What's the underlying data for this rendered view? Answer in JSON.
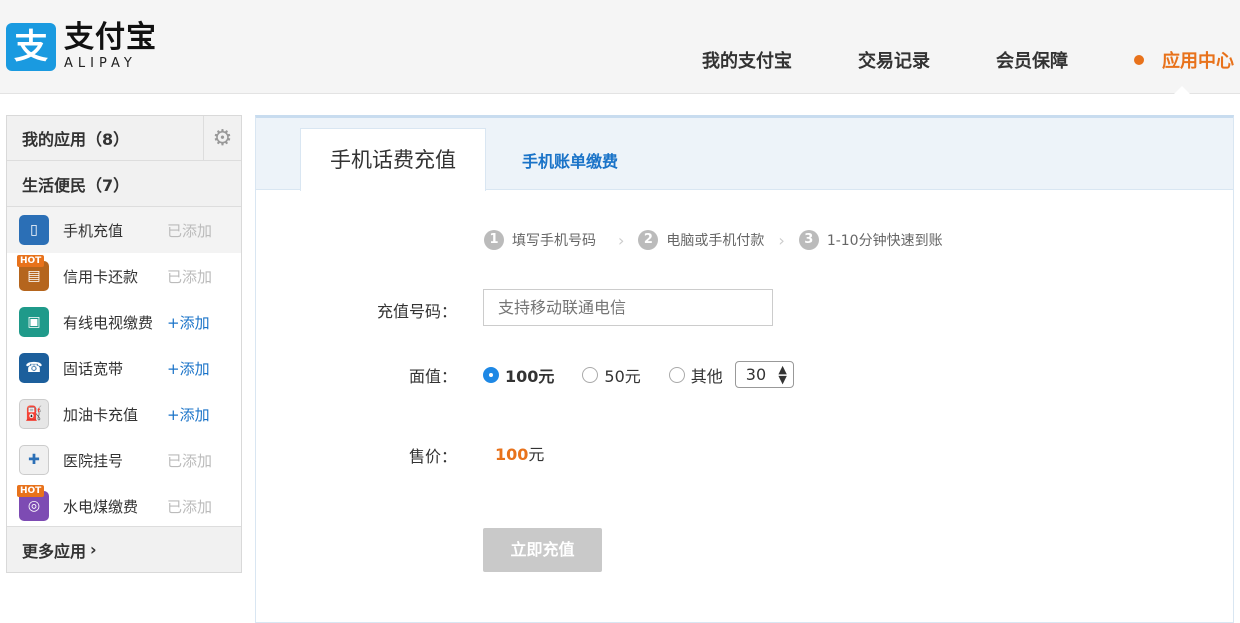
{
  "header": {
    "logo_mark": "支",
    "logo_cn": "支付宝",
    "logo_en": "ALIPAY",
    "nav": [
      {
        "label": "我的支付宝"
      },
      {
        "label": "交易记录"
      },
      {
        "label": "会员保障"
      },
      {
        "label": "应用中心"
      }
    ]
  },
  "sidebar": {
    "my_apps": "我的应用（8）",
    "category": "生活便民（7）",
    "items": [
      {
        "label": "手机充值",
        "action": "已添加",
        "icon": "phone-icon",
        "color": "#2b6fb6",
        "hot": false
      },
      {
        "label": "信用卡还款",
        "action": "已添加",
        "icon": "credit-card-icon",
        "color": "#b5651d",
        "hot": true
      },
      {
        "label": "有线电视缴费",
        "action": "+添加",
        "icon": "tv-icon",
        "color": "#1f9a8a",
        "hot": false
      },
      {
        "label": "固话宽带",
        "action": "+添加",
        "icon": "landline-icon",
        "color": "#1c5f9c",
        "hot": false
      },
      {
        "label": "加油卡充值",
        "action": "+添加",
        "icon": "fuel-icon",
        "color": "#e6e6e6",
        "hot": false
      },
      {
        "label": "医院挂号",
        "action": "已添加",
        "icon": "hospital-icon",
        "color": "#f0f0f0",
        "hot": false
      },
      {
        "label": "水电煤缴费",
        "action": "已添加",
        "icon": "utilities-icon",
        "color": "#7d4bb3",
        "hot": true
      }
    ],
    "hot_badge": "HOT",
    "more": "更多应用"
  },
  "main": {
    "tab_active": "手机话费充值",
    "tab_other": "手机账单缴费",
    "steps": [
      {
        "num": "1",
        "text": "填写手机号码"
      },
      {
        "num": "2",
        "text": "电脑或手机付款"
      },
      {
        "num": "3",
        "text": "1-10分钟快速到账"
      }
    ],
    "phone_label": "充值号码：",
    "phone_placeholder": "支持移动联通电信",
    "amount_label": "面值：",
    "amount_options": [
      {
        "label": "100元",
        "checked": true
      },
      {
        "label": "50元",
        "checked": false
      },
      {
        "label": "其他",
        "checked": false
      }
    ],
    "other_value": "30",
    "price_label": "售价：",
    "price_value": "100",
    "price_unit": "元",
    "submit": "立即充值"
  },
  "colors": {
    "accent": "#e8721b",
    "link": "#1a73c8",
    "brand": "#1a9ae0"
  }
}
